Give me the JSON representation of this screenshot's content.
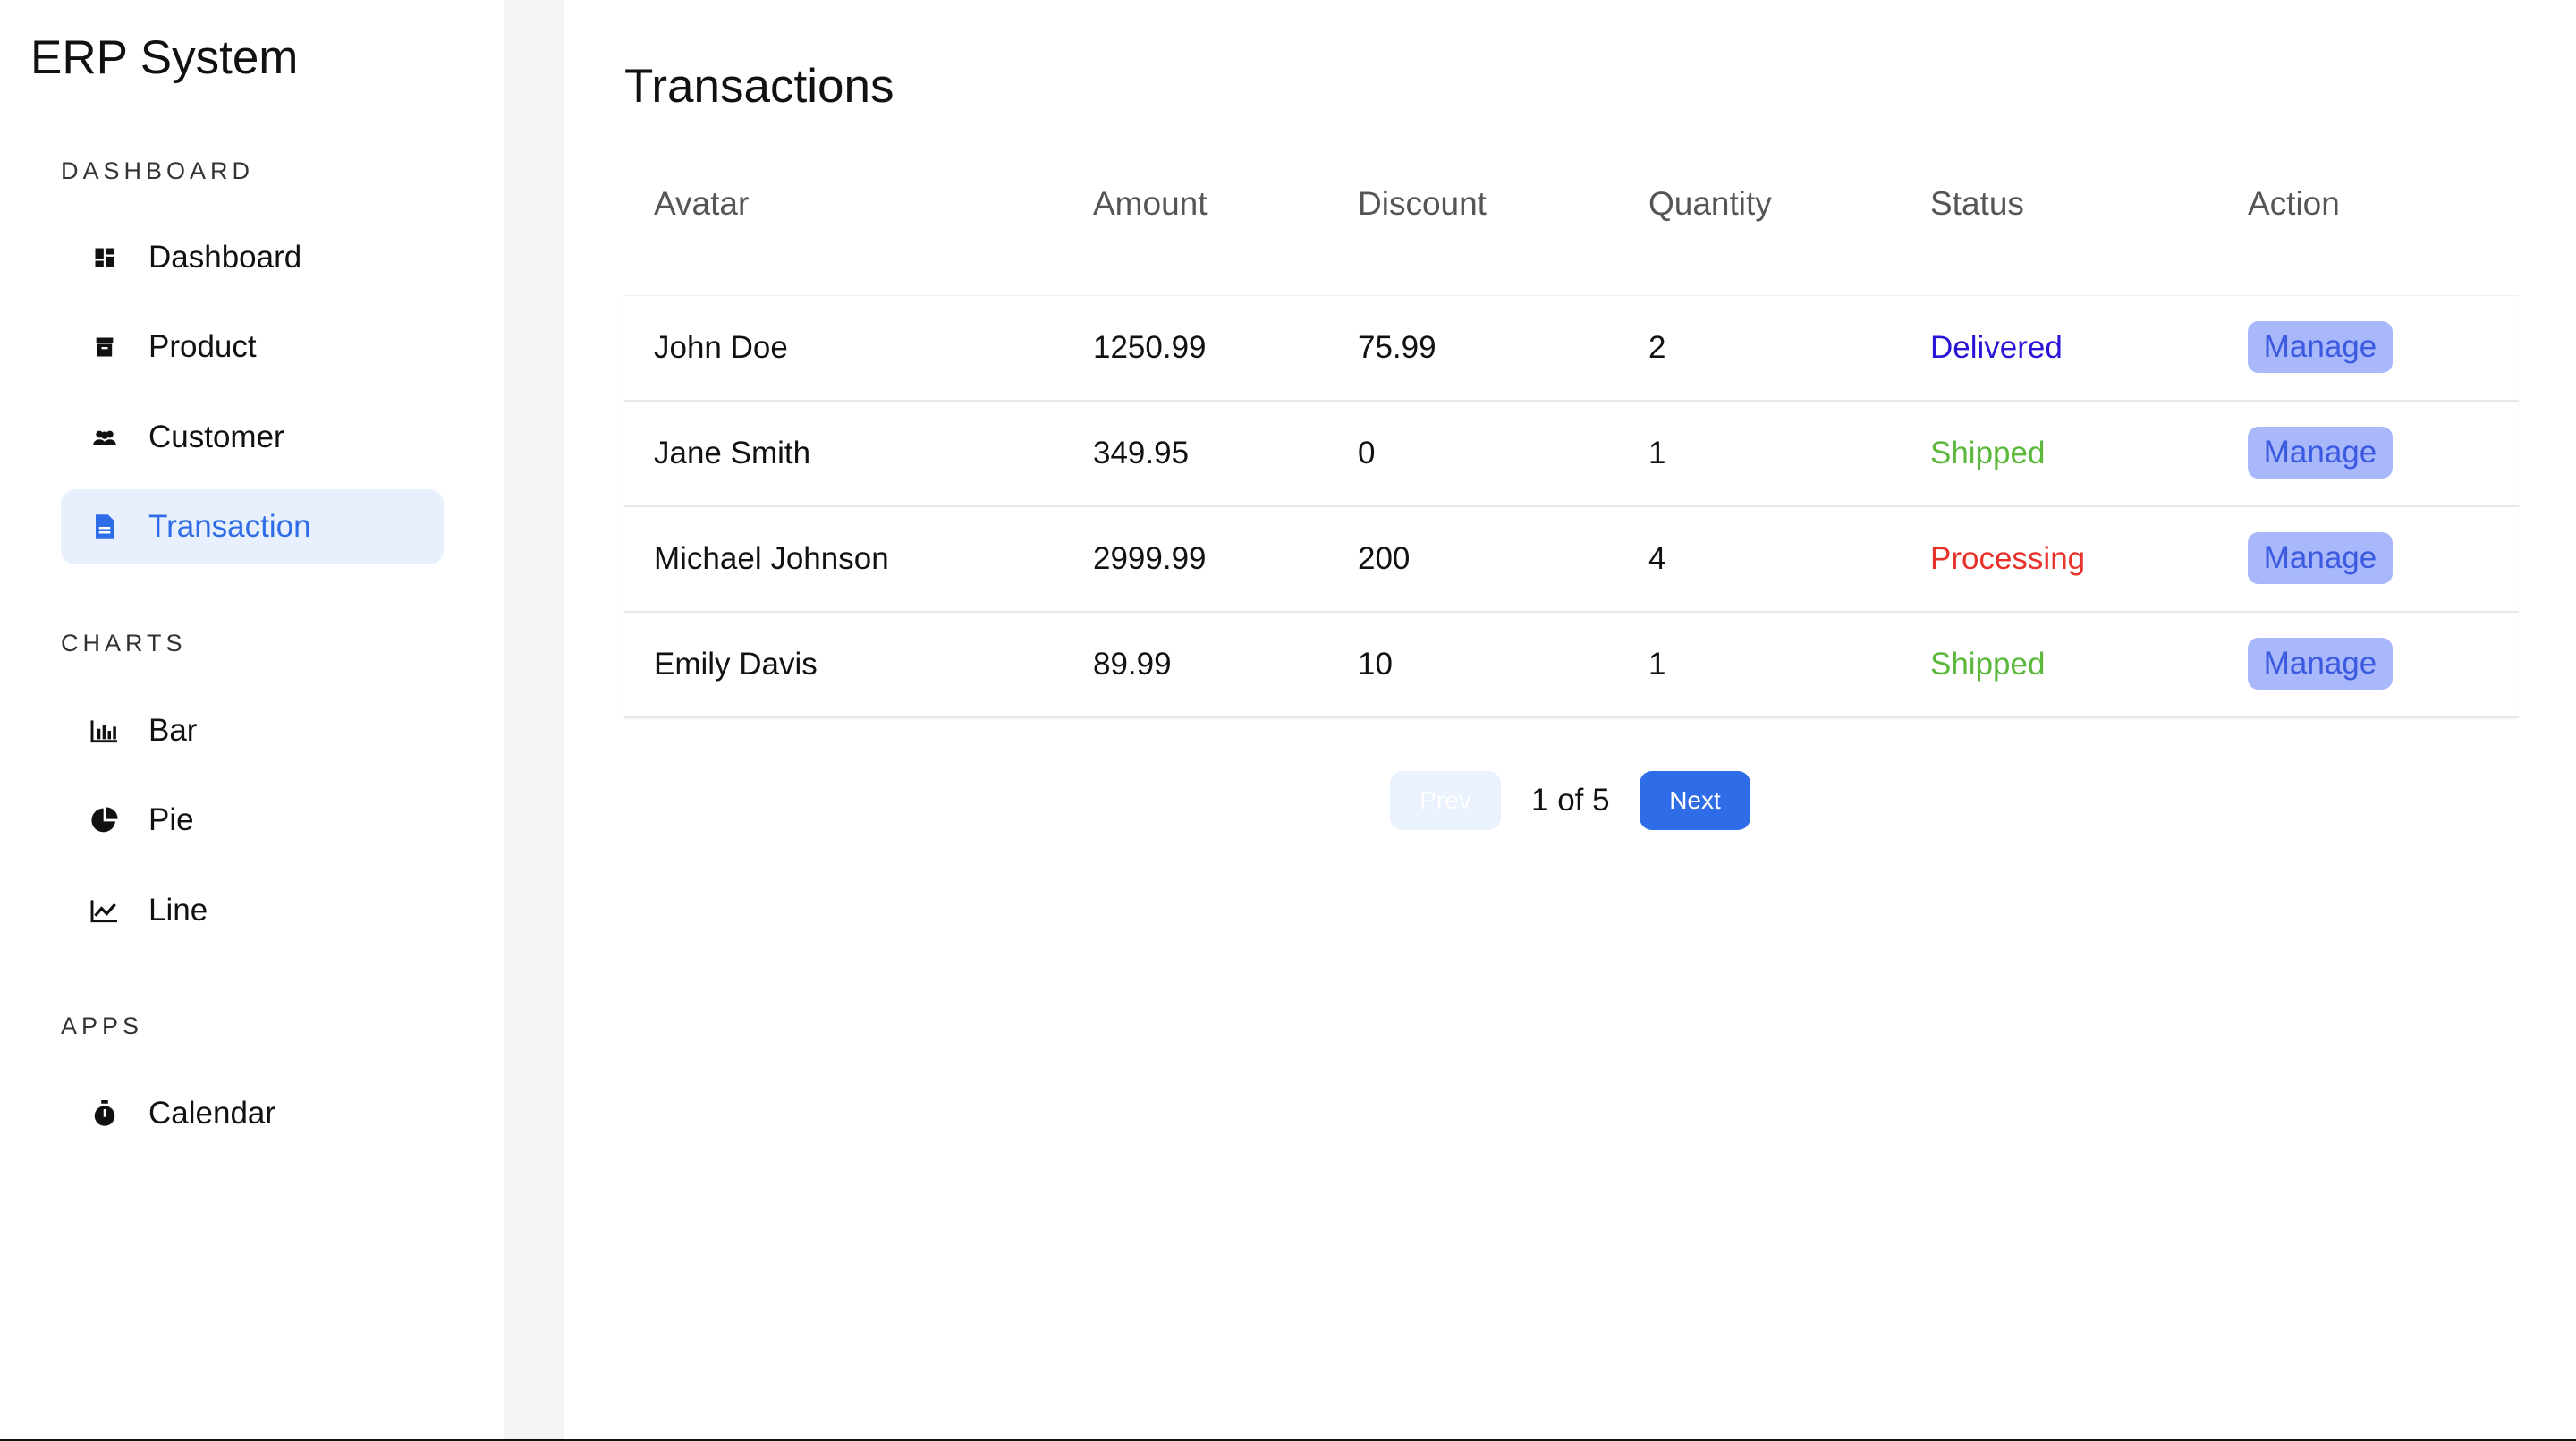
{
  "app": {
    "title": "ERP System"
  },
  "sidebar": {
    "sections": [
      {
        "label": "DASHBOARD",
        "items": [
          {
            "label": "Dashboard",
            "icon": "dashboard-icon",
            "active": false
          },
          {
            "label": "Product",
            "icon": "box-icon",
            "active": false
          },
          {
            "label": "Customer",
            "icon": "people-icon",
            "active": false
          },
          {
            "label": "Transaction",
            "icon": "document-icon",
            "active": true
          }
        ]
      },
      {
        "label": "CHARTS",
        "items": [
          {
            "label": "Bar",
            "icon": "bar-chart-icon",
            "active": false
          },
          {
            "label": "Pie",
            "icon": "pie-chart-icon",
            "active": false
          },
          {
            "label": "Line",
            "icon": "line-chart-icon",
            "active": false
          }
        ]
      },
      {
        "label": "APPS",
        "items": [
          {
            "label": "Calendar",
            "icon": "stopwatch-icon",
            "active": false
          }
        ]
      }
    ]
  },
  "main": {
    "title": "Transactions",
    "table": {
      "headers": [
        "Avatar",
        "Amount",
        "Discount",
        "Quantity",
        "Status",
        "Action"
      ],
      "rows": [
        {
          "avatar": "John Doe",
          "amount": "1250.99",
          "discount": "75.99",
          "quantity": "2",
          "status": "Delivered",
          "action": "Manage"
        },
        {
          "avatar": "Jane Smith",
          "amount": "349.95",
          "discount": "0",
          "quantity": "1",
          "status": "Shipped",
          "action": "Manage"
        },
        {
          "avatar": "Michael Johnson",
          "amount": "2999.99",
          "discount": "200",
          "quantity": "4",
          "status": "Processing",
          "action": "Manage"
        },
        {
          "avatar": "Emily Davis",
          "amount": "89.99",
          "discount": "10",
          "quantity": "1",
          "status": "Shipped",
          "action": "Manage"
        }
      ]
    },
    "pagination": {
      "prev_label": "Prev",
      "page_info": "1 of 5",
      "next_label": "Next"
    }
  },
  "colors": {
    "accent": "#2f6ce8",
    "active_bg": "#e8f0fd",
    "status_delivered": "#2a14d6",
    "status_shipped": "#5cb83c",
    "status_processing": "#e8322c",
    "manage_bg": "#a8b8fb",
    "manage_text": "#3c5ae0"
  }
}
